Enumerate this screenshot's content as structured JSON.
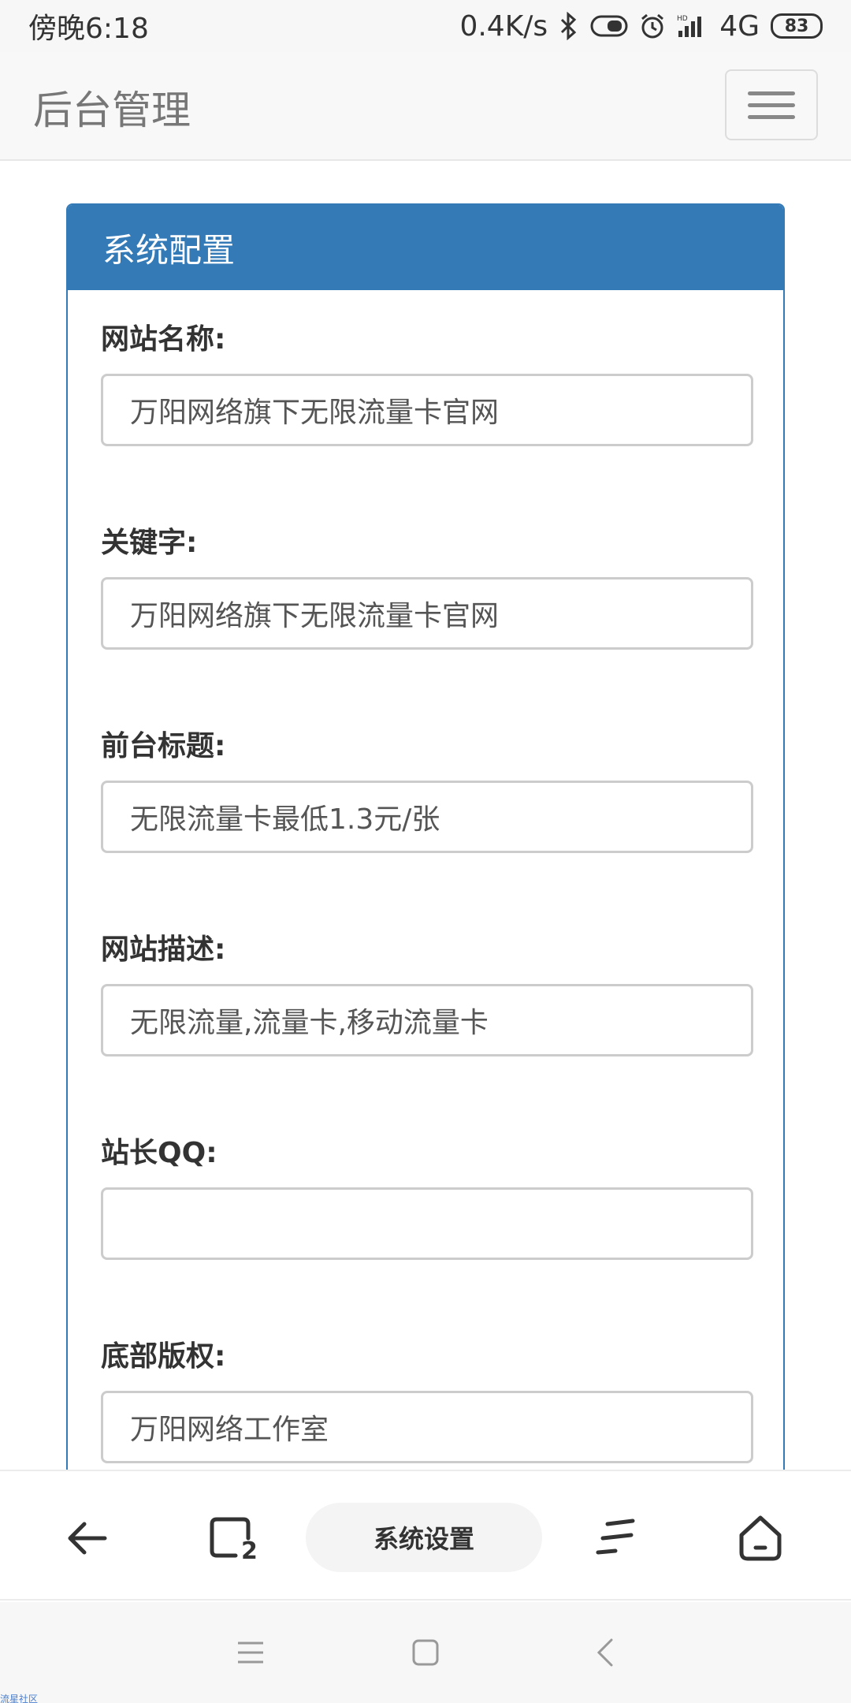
{
  "status_bar": {
    "time": "傍晚6:18",
    "network_speed": "0.4K/s",
    "signal_label": "4G",
    "battery": "83"
  },
  "navbar": {
    "brand": "后台管理"
  },
  "panel": {
    "title": "系统配置",
    "fields": [
      {
        "label": "网站名称:",
        "value": "万阳网络旗下无限流量卡官网"
      },
      {
        "label": "关键字:",
        "value": "万阳网络旗下无限流量卡官网"
      },
      {
        "label": "前台标题:",
        "value": "无限流量卡最低1.3元/张"
      },
      {
        "label": "网站描述:",
        "value": "无限流量,流量卡,移动流量卡"
      },
      {
        "label": "站长QQ:",
        "value": ""
      },
      {
        "label": "底部版权:",
        "value": "万阳网络工作室"
      }
    ]
  },
  "browser_bar": {
    "tab_count": "2",
    "current_tab_label": "系统设置"
  },
  "watermark": "流星社区",
  "colors": {
    "primary": "#337ab7",
    "navbar_bg": "#f8f8f8",
    "border": "#cccccc"
  }
}
